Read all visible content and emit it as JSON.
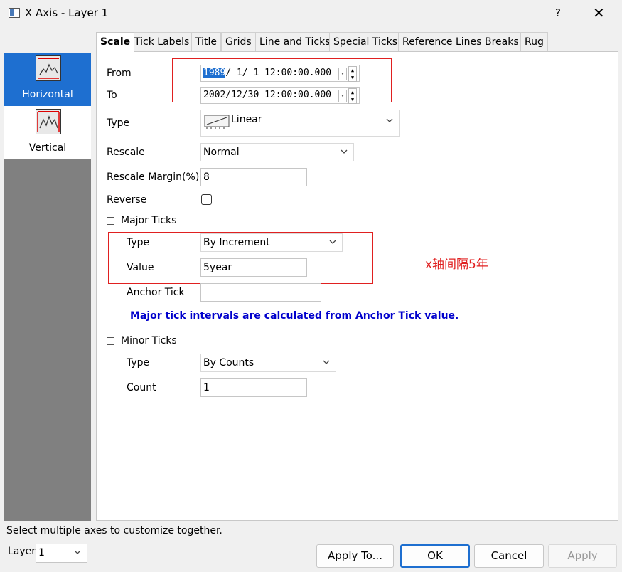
{
  "window": {
    "title": "X Axis - Layer 1",
    "help": "?",
    "close": "✕"
  },
  "sidebar": {
    "items": [
      {
        "label": "Horizontal",
        "active": true,
        "icon": "horizontal-axis-icon"
      },
      {
        "label": "Vertical",
        "active": false,
        "icon": "vertical-axis-icon"
      }
    ]
  },
  "tabs": [
    "Scale",
    "Tick Labels",
    "Title",
    "Grids",
    "Line and Ticks",
    "Special Ticks",
    "Reference Lines",
    "Breaks",
    "Rug"
  ],
  "scale": {
    "from_label": "From",
    "from_selected": "1989",
    "from_rest": "/ 1/ 1 12:00:00.000",
    "to_label": "To",
    "to_value": "2002/12/30 12:00:00.000",
    "type_label": "Type",
    "type_value": "Linear",
    "rescale_label": "Rescale",
    "rescale_value": "Normal",
    "rescale_margin_label": "Rescale Margin(%)",
    "rescale_margin_value": "8",
    "reverse_label": "Reverse"
  },
  "major_ticks": {
    "header": "Major Ticks",
    "type_label": "Type",
    "type_value": "By Increment",
    "value_label": "Value",
    "value_value": "5year",
    "anchor_label": "Anchor Tick",
    "anchor_value": "",
    "info": "Major tick intervals are calculated from Anchor Tick value."
  },
  "minor_ticks": {
    "header": "Minor Ticks",
    "type_label": "Type",
    "type_value": "By Counts",
    "count_label": "Count",
    "count_value": "1"
  },
  "annotation": {
    "text": "x轴间隔5年"
  },
  "footer": {
    "status": "Select multiple axes to customize together.",
    "layer_label": "Layer",
    "layer_value": "1",
    "apply_to": "Apply To...",
    "ok": "OK",
    "cancel": "Cancel",
    "apply": "Apply"
  },
  "colors": {
    "accent": "#1e6fd0",
    "annotation_red": "#e02020",
    "info_blue": "#0000cc"
  }
}
